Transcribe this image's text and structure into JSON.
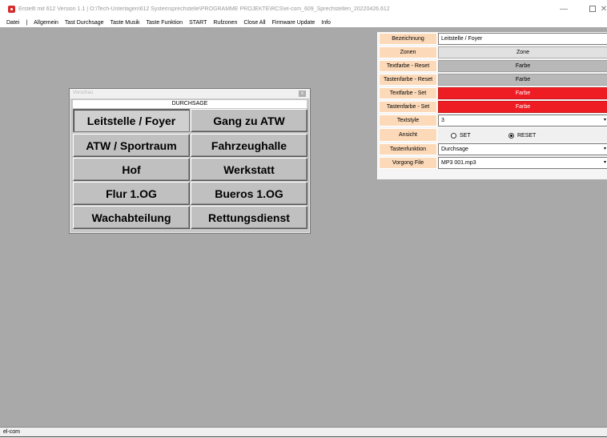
{
  "window": {
    "title": "Erstellt mit 612 Version 1.1 | O:\\Tech-Unterlagen\\612 Systemsprechstelle\\PROGRAMME PROJEKTE\\RCS\\el-com_609_Sprechstellen_20220426.612",
    "minimize": "—",
    "close": "✕"
  },
  "menu": {
    "items": [
      "Datei",
      "|",
      "Allgemein",
      "Tast Durchsage",
      "Taste Musik",
      "Taste Funktion",
      "START",
      "Rufzonen",
      "Close All",
      "Firmware Update",
      "Info"
    ]
  },
  "preview": {
    "title": "Vorschau",
    "close": "x",
    "header": "DURCHSAGE",
    "buttons": [
      "Leitstelle / Foyer",
      "Gang zu ATW",
      "ATW / Sportraum",
      "Fahrzeughalle",
      "Hof",
      "Werkstatt",
      "Flur 1.OG",
      "Bueros 1.OG",
      "Wachabteilung",
      "Rettungsdienst"
    ]
  },
  "properties": {
    "bezeichnung": {
      "label": "Bezeichnung",
      "value": "Leitstelle / Foyer"
    },
    "zonen": {
      "label": "Zonen",
      "value": "Zone"
    },
    "textfarbe_reset": {
      "label": "Textfarbe - Reset",
      "value": "Farbe"
    },
    "tastenfarbe_reset": {
      "label": "Tastenfarbe - Reset",
      "value": "Farbe"
    },
    "textfarbe_set": {
      "label": "Textfarbe - Set",
      "value": "Farbe"
    },
    "tastenfarbe_set": {
      "label": "Tastenfarbe - Set",
      "value": "Farbe"
    },
    "textstyle": {
      "label": "Textstyle",
      "value": "3"
    },
    "ansicht": {
      "label": "Ansicht",
      "set": "SET",
      "reset": "RESET",
      "selected": "RESET"
    },
    "tastenfunktion": {
      "label": "Tastenfunktion",
      "value": "Durchsage"
    },
    "vorgong_file": {
      "label": "Vorgong File",
      "value": "MP3 001.mp3"
    }
  },
  "status": {
    "text": "el-com"
  },
  "colors": {
    "accent_red": "#ee1d24",
    "label_bg": "#fcd9b8",
    "workspace": "#a9a9a9"
  }
}
